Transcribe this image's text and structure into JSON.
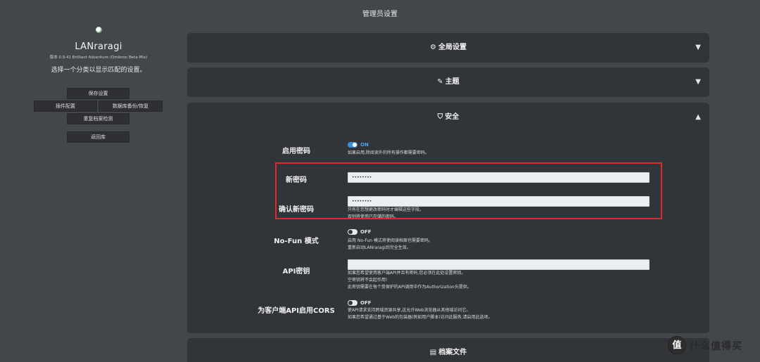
{
  "page": {
    "title": "管理员设置"
  },
  "sidebar": {
    "app_name": "LANraragi",
    "version": "版本 0.9.41 Brilliant Adventure (Omikron Beta Mix)",
    "description": "选择一个分类以显示匹配的设置。",
    "buttons": {
      "save": "保存设置",
      "plugins": "插件配置",
      "backup": "数据库备份/恢复",
      "dup_check": "重复档案检测",
      "back": "返回库"
    }
  },
  "sections": {
    "global": {
      "title": "全局设置",
      "icon": "cogs-icon"
    },
    "theme": {
      "title": "主题",
      "icon": "paint-brush-icon"
    },
    "security": {
      "title": "安全",
      "icon": "shield-icon"
    },
    "archives": {
      "title": "档案文件",
      "icon": "file-icon"
    }
  },
  "security": {
    "enable_password": {
      "label": "启用密码",
      "state": "ON",
      "desc": "如果启用,除阅读外的所有操作都需要密码。"
    },
    "new_password": {
      "label": "新密码",
      "value": "••••••••"
    },
    "confirm_password": {
      "label": "确认新密码",
      "value": "••••••••",
      "desc": "只有在您想更改密码时才编辑这些字段。",
      "desc2": "否则将使用已存储的密码。"
    },
    "nofun": {
      "label": "No-Fun 模式",
      "state": "OFF",
      "desc1": "启用 No-Fun 模式将使阅读档案也需要密码。",
      "desc2": "重新启动LANraragi后完全生效。"
    },
    "api_key": {
      "label": "API密钥",
      "value": "",
      "desc1": "如果您希望使用客户端API并且有密码,您必须在此处设置密钥。",
      "desc2": "空密钥将不会起作用!",
      "desc3_pre": "此密钥需要在每个受保护的API调用中作为",
      "desc3_em": "Authorization",
      "desc3_post": "头提供。"
    },
    "cors": {
      "label": "为客户端API启用CORS",
      "state": "OFF",
      "desc1": "使API请求支持跨域资源共享,这允许Web浏览器从其他域访问它。",
      "desc2": "如果您希望通过基于Web的包装器(例如用户脚本)访问此服务,请启用此选项。"
    }
  },
  "watermark": {
    "glyph": "值",
    "text": "什么值得买"
  },
  "colors": {
    "accent": "#3b8ee0",
    "highlight": "#e4262b",
    "panel": "#313438",
    "background": "#43464b"
  }
}
